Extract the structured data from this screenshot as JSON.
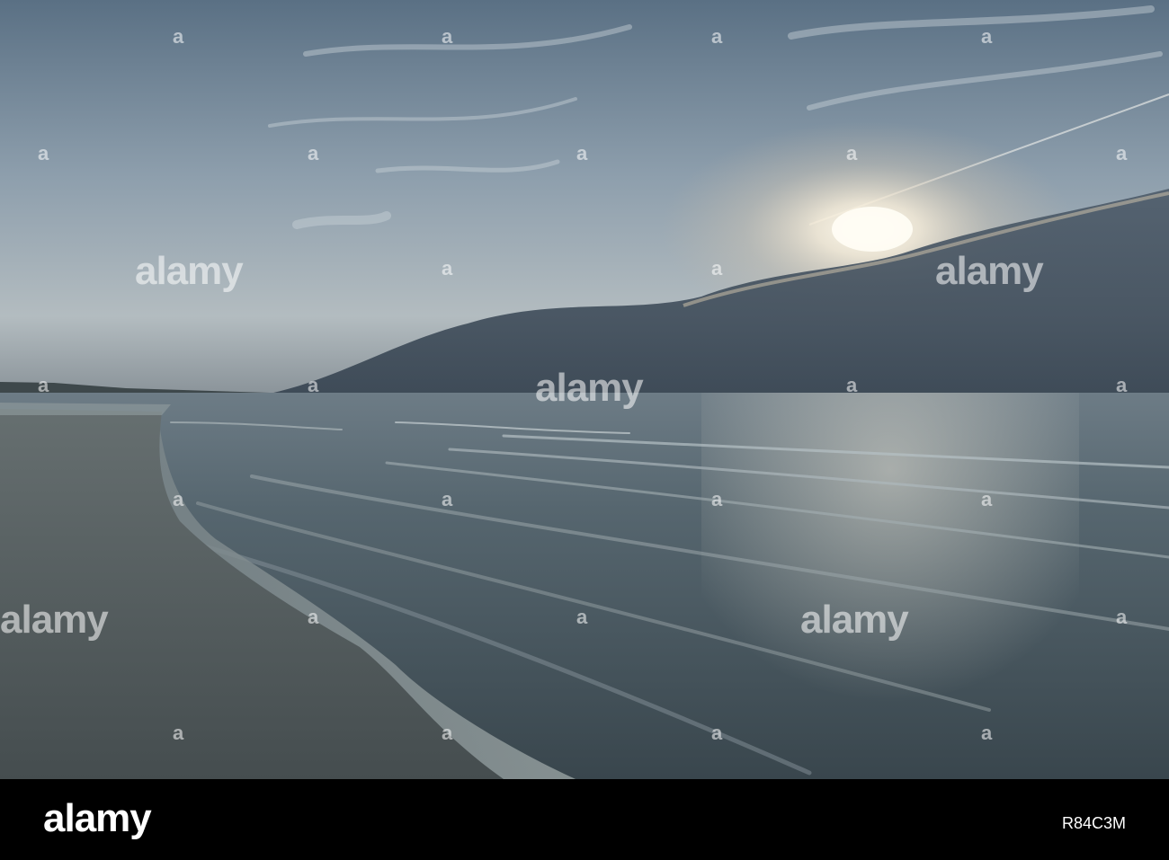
{
  "watermark": {
    "brand": "alamy",
    "small_mark": "a"
  },
  "footer": {
    "logo_text": "alamy",
    "image_id": "R84C3M"
  },
  "colors": {
    "sky_top": "#5f7689",
    "sky_mid": "#a9b8c2",
    "sun_glow": "#fdf6e6",
    "cloud_dark": "#3c4a58",
    "sea": "#4d5f6b",
    "sand": "#555f62",
    "footer_bg": "#000000"
  }
}
